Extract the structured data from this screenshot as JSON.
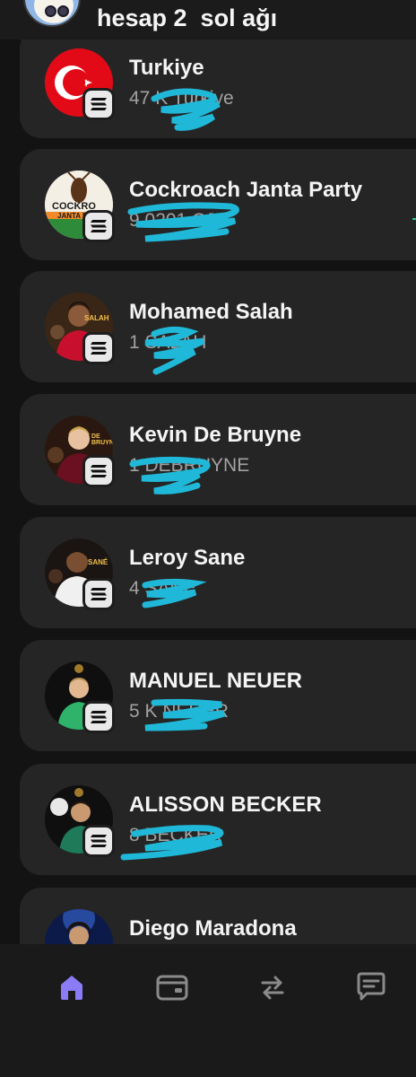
{
  "header": {
    "title": "hesap 2  sol ağı",
    "avatar_icon": "cartoon-avatar-icon"
  },
  "accounts": [
    {
      "name": "Turkiye",
      "sub": "47 K Turkiye"
    },
    {
      "name": "Cockroach Janta Party",
      "sub": "9 0201 CJP",
      "logo_text": "COCKRO",
      "logo_text2": "JANTA P"
    },
    {
      "name": "Mohamed Salah",
      "sub": "1 SALAH",
      "logo_text": "SALAH"
    },
    {
      "name": "Kevin De Bruyne",
      "sub": "1 DEBRUYNE",
      "logo_text": "DE BRUYNE"
    },
    {
      "name": "Leroy Sane",
      "sub": "4 SANE",
      "logo_text": "SANÉ"
    },
    {
      "name": "MANUEL NEUER",
      "sub": "5 K NEUER"
    },
    {
      "name": "ALISSON BECKER",
      "sub": "8 BECKER"
    },
    {
      "name": "Diego Maradona",
      "sub": ""
    }
  ],
  "badge_icon": "solana-logo-icon",
  "tabbar": {
    "items": [
      {
        "icon": "home-icon",
        "active": true
      },
      {
        "icon": "wallet-icon",
        "active": false
      },
      {
        "icon": "swap-icon",
        "active": false
      },
      {
        "icon": "chat-icon",
        "active": false
      }
    ]
  },
  "colors": {
    "accent": "#8b7cf6",
    "scribble": "#20b8d8",
    "card": "#252525",
    "background": "#131313"
  }
}
